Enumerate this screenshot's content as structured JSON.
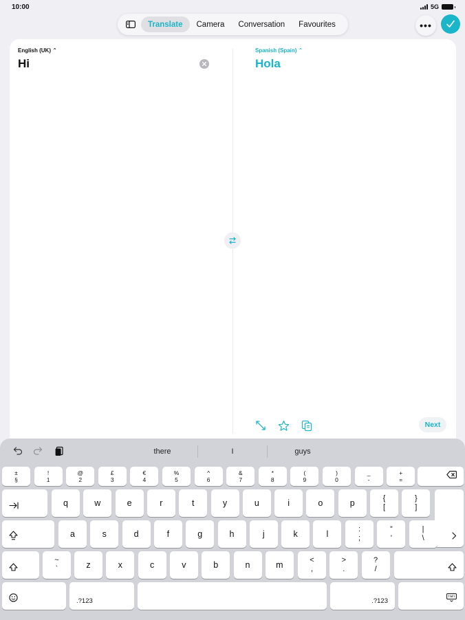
{
  "status": {
    "time": "10:00",
    "network": "5G"
  },
  "toolbar": {
    "sidebar_icon": "sidebar-icon",
    "tabs": [
      {
        "label": "Translate",
        "active": true
      },
      {
        "label": "Camera",
        "active": false
      },
      {
        "label": "Conversation",
        "active": false
      },
      {
        "label": "Favourites",
        "active": false
      }
    ],
    "more_label": "•••",
    "done_icon": "checkmark-icon"
  },
  "source": {
    "language": "English (UK) ⌃",
    "text": "Hi"
  },
  "target": {
    "language": "Spanish (Spain) ⌃",
    "text": "Hola"
  },
  "actions": {
    "next_label": "Next"
  },
  "keyboard": {
    "suggestions": [
      "there",
      "I",
      "guys"
    ],
    "number_row": [
      {
        "top": "±",
        "bottom": "§"
      },
      {
        "top": "!",
        "bottom": "1"
      },
      {
        "top": "@",
        "bottom": "2"
      },
      {
        "top": "£",
        "bottom": "3"
      },
      {
        "top": "€",
        "bottom": "4"
      },
      {
        "top": "%",
        "bottom": "5"
      },
      {
        "top": "^",
        "bottom": "6"
      },
      {
        "top": "&",
        "bottom": "7"
      },
      {
        "top": "*",
        "bottom": "8"
      },
      {
        "top": "(",
        "bottom": "9"
      },
      {
        "top": ")",
        "bottom": "0"
      },
      {
        "top": "_",
        "bottom": "-"
      },
      {
        "top": "+",
        "bottom": "="
      }
    ],
    "row1": [
      "q",
      "w",
      "e",
      "r",
      "t",
      "y",
      "u",
      "i",
      "o",
      "p"
    ],
    "row1_extra": [
      {
        "top": "{",
        "bottom": "["
      },
      {
        "top": "}",
        "bottom": "]"
      }
    ],
    "row2": [
      "a",
      "s",
      "d",
      "f",
      "g",
      "h",
      "j",
      "k",
      "l"
    ],
    "row2_extra": [
      {
        "top": ":",
        "bottom": ";"
      },
      {
        "top": "”",
        "bottom": "’"
      },
      {
        "top": "|",
        "bottom": "\\"
      }
    ],
    "row3_first": {
      "top": "~",
      "bottom": "`"
    },
    "row3": [
      "z",
      "x",
      "c",
      "v",
      "b",
      "n",
      "m"
    ],
    "row3_extra": [
      {
        "top": "<",
        "bottom": ","
      },
      {
        "top": ">",
        "bottom": "."
      },
      {
        "top": "?",
        "bottom": "/"
      }
    ],
    "numbers_label": ".?123",
    "numbers_label_right": ".?123"
  },
  "colors": {
    "accent": "#1ab5c8",
    "background": "#f0f0f4",
    "keyboard": "#d1d3d9"
  }
}
